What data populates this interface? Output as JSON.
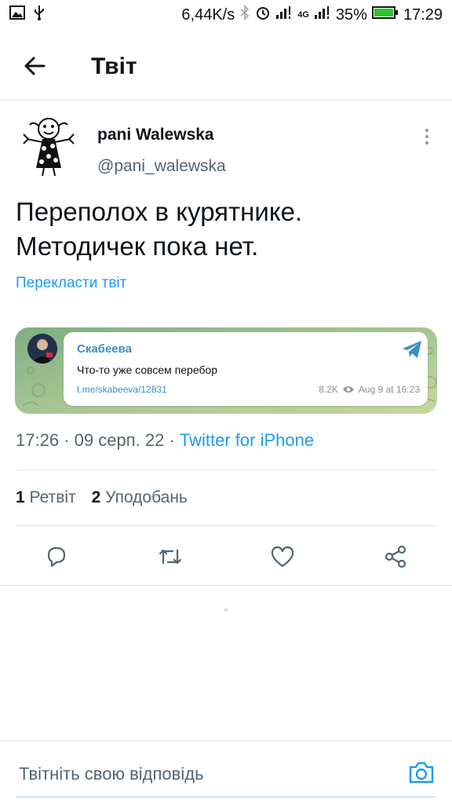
{
  "status_bar": {
    "speed": "6,44K/s",
    "network": "4G",
    "battery": "35%",
    "time": "17:29"
  },
  "header": {
    "title": "Твіт"
  },
  "tweet": {
    "author_name": "pani Walewska",
    "author_handle": "@pani_walewska",
    "text_lines": [
      "Переполох в курятнике.",
      "Методичек пока нет."
    ],
    "translate": "Перекласти твіт",
    "card": {
      "channel": "Скабеева",
      "message": "Что-то уже совсем перебор",
      "link": "t.me/skabeeva/12831",
      "views": "8.2K",
      "date": "Aug 9 at 16:23"
    },
    "time": "17:26",
    "date": "09 серп. 22",
    "separator": "·",
    "source": "Twitter for iPhone",
    "retweets_count": "1",
    "retweets_label": "Ретвіт",
    "likes_count": "2",
    "likes_label": "Уподобань"
  },
  "reply": {
    "placeholder": "Твітніть свою відповідь"
  },
  "colors": {
    "accent": "#1d9bf0",
    "secondary_text": "#536471",
    "card_green": "#8db58a",
    "telegram_blue": "#3a8ec9"
  },
  "icons": [
    "image-icon",
    "usb-icon",
    "bluetooth-icon",
    "alarm-icon",
    "signal-icon",
    "battery-icon",
    "back-arrow-icon",
    "more-vertical-icon",
    "telegram-plane-icon",
    "eye-icon",
    "reply-icon",
    "retweet-icon",
    "like-icon",
    "share-icon",
    "camera-icon"
  ]
}
